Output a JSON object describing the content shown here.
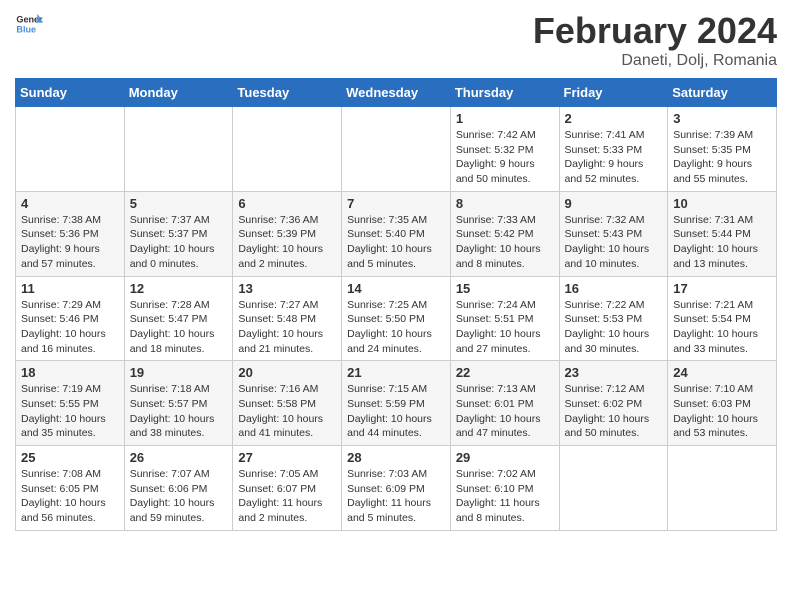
{
  "header": {
    "logo_general": "General",
    "logo_blue": "Blue",
    "month": "February 2024",
    "location": "Daneti, Dolj, Romania"
  },
  "weekdays": [
    "Sunday",
    "Monday",
    "Tuesday",
    "Wednesday",
    "Thursday",
    "Friday",
    "Saturday"
  ],
  "weeks": [
    [
      {
        "day": "",
        "info": ""
      },
      {
        "day": "",
        "info": ""
      },
      {
        "day": "",
        "info": ""
      },
      {
        "day": "",
        "info": ""
      },
      {
        "day": "1",
        "info": "Sunrise: 7:42 AM\nSunset: 5:32 PM\nDaylight: 9 hours\nand 50 minutes."
      },
      {
        "day": "2",
        "info": "Sunrise: 7:41 AM\nSunset: 5:33 PM\nDaylight: 9 hours\nand 52 minutes."
      },
      {
        "day": "3",
        "info": "Sunrise: 7:39 AM\nSunset: 5:35 PM\nDaylight: 9 hours\nand 55 minutes."
      }
    ],
    [
      {
        "day": "4",
        "info": "Sunrise: 7:38 AM\nSunset: 5:36 PM\nDaylight: 9 hours\nand 57 minutes."
      },
      {
        "day": "5",
        "info": "Sunrise: 7:37 AM\nSunset: 5:37 PM\nDaylight: 10 hours\nand 0 minutes."
      },
      {
        "day": "6",
        "info": "Sunrise: 7:36 AM\nSunset: 5:39 PM\nDaylight: 10 hours\nand 2 minutes."
      },
      {
        "day": "7",
        "info": "Sunrise: 7:35 AM\nSunset: 5:40 PM\nDaylight: 10 hours\nand 5 minutes."
      },
      {
        "day": "8",
        "info": "Sunrise: 7:33 AM\nSunset: 5:42 PM\nDaylight: 10 hours\nand 8 minutes."
      },
      {
        "day": "9",
        "info": "Sunrise: 7:32 AM\nSunset: 5:43 PM\nDaylight: 10 hours\nand 10 minutes."
      },
      {
        "day": "10",
        "info": "Sunrise: 7:31 AM\nSunset: 5:44 PM\nDaylight: 10 hours\nand 13 minutes."
      }
    ],
    [
      {
        "day": "11",
        "info": "Sunrise: 7:29 AM\nSunset: 5:46 PM\nDaylight: 10 hours\nand 16 minutes."
      },
      {
        "day": "12",
        "info": "Sunrise: 7:28 AM\nSunset: 5:47 PM\nDaylight: 10 hours\nand 18 minutes."
      },
      {
        "day": "13",
        "info": "Sunrise: 7:27 AM\nSunset: 5:48 PM\nDaylight: 10 hours\nand 21 minutes."
      },
      {
        "day": "14",
        "info": "Sunrise: 7:25 AM\nSunset: 5:50 PM\nDaylight: 10 hours\nand 24 minutes."
      },
      {
        "day": "15",
        "info": "Sunrise: 7:24 AM\nSunset: 5:51 PM\nDaylight: 10 hours\nand 27 minutes."
      },
      {
        "day": "16",
        "info": "Sunrise: 7:22 AM\nSunset: 5:53 PM\nDaylight: 10 hours\nand 30 minutes."
      },
      {
        "day": "17",
        "info": "Sunrise: 7:21 AM\nSunset: 5:54 PM\nDaylight: 10 hours\nand 33 minutes."
      }
    ],
    [
      {
        "day": "18",
        "info": "Sunrise: 7:19 AM\nSunset: 5:55 PM\nDaylight: 10 hours\nand 35 minutes."
      },
      {
        "day": "19",
        "info": "Sunrise: 7:18 AM\nSunset: 5:57 PM\nDaylight: 10 hours\nand 38 minutes."
      },
      {
        "day": "20",
        "info": "Sunrise: 7:16 AM\nSunset: 5:58 PM\nDaylight: 10 hours\nand 41 minutes."
      },
      {
        "day": "21",
        "info": "Sunrise: 7:15 AM\nSunset: 5:59 PM\nDaylight: 10 hours\nand 44 minutes."
      },
      {
        "day": "22",
        "info": "Sunrise: 7:13 AM\nSunset: 6:01 PM\nDaylight: 10 hours\nand 47 minutes."
      },
      {
        "day": "23",
        "info": "Sunrise: 7:12 AM\nSunset: 6:02 PM\nDaylight: 10 hours\nand 50 minutes."
      },
      {
        "day": "24",
        "info": "Sunrise: 7:10 AM\nSunset: 6:03 PM\nDaylight: 10 hours\nand 53 minutes."
      }
    ],
    [
      {
        "day": "25",
        "info": "Sunrise: 7:08 AM\nSunset: 6:05 PM\nDaylight: 10 hours\nand 56 minutes."
      },
      {
        "day": "26",
        "info": "Sunrise: 7:07 AM\nSunset: 6:06 PM\nDaylight: 10 hours\nand 59 minutes."
      },
      {
        "day": "27",
        "info": "Sunrise: 7:05 AM\nSunset: 6:07 PM\nDaylight: 11 hours\nand 2 minutes."
      },
      {
        "day": "28",
        "info": "Sunrise: 7:03 AM\nSunset: 6:09 PM\nDaylight: 11 hours\nand 5 minutes."
      },
      {
        "day": "29",
        "info": "Sunrise: 7:02 AM\nSunset: 6:10 PM\nDaylight: 11 hours\nand 8 minutes."
      },
      {
        "day": "",
        "info": ""
      },
      {
        "day": "",
        "info": ""
      }
    ]
  ]
}
